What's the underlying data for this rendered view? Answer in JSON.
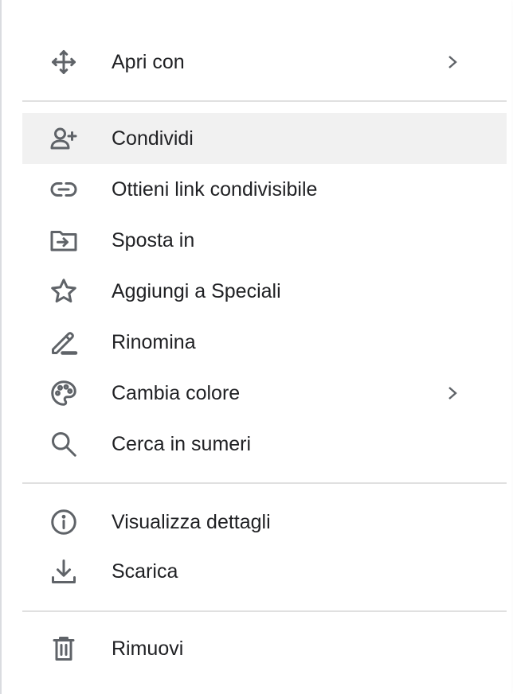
{
  "menu": {
    "items": [
      {
        "label": "Apri con",
        "icon": "move-icon",
        "submenu": true
      },
      {
        "label": "Condividi",
        "icon": "person-add-icon",
        "highlighted": true
      },
      {
        "label": "Ottieni link condivisibile",
        "icon": "link-icon"
      },
      {
        "label": "Sposta in",
        "icon": "move-to-folder-icon"
      },
      {
        "label": "Aggiungi a Speciali",
        "icon": "star-icon"
      },
      {
        "label": "Rinomina",
        "icon": "pencil-icon"
      },
      {
        "label": "Cambia colore",
        "icon": "palette-icon",
        "submenu": true
      },
      {
        "label": "Cerca in sumeri",
        "icon": "search-icon"
      },
      {
        "label": "Visualizza dettagli",
        "icon": "info-icon"
      },
      {
        "label": "Scarica",
        "icon": "download-icon"
      },
      {
        "label": "Rimuovi",
        "icon": "trash-icon"
      }
    ]
  },
  "colors": {
    "icon": "#5f6368",
    "text": "#202124",
    "highlight": "#f1f1f1",
    "divider": "#e0e0e0"
  }
}
